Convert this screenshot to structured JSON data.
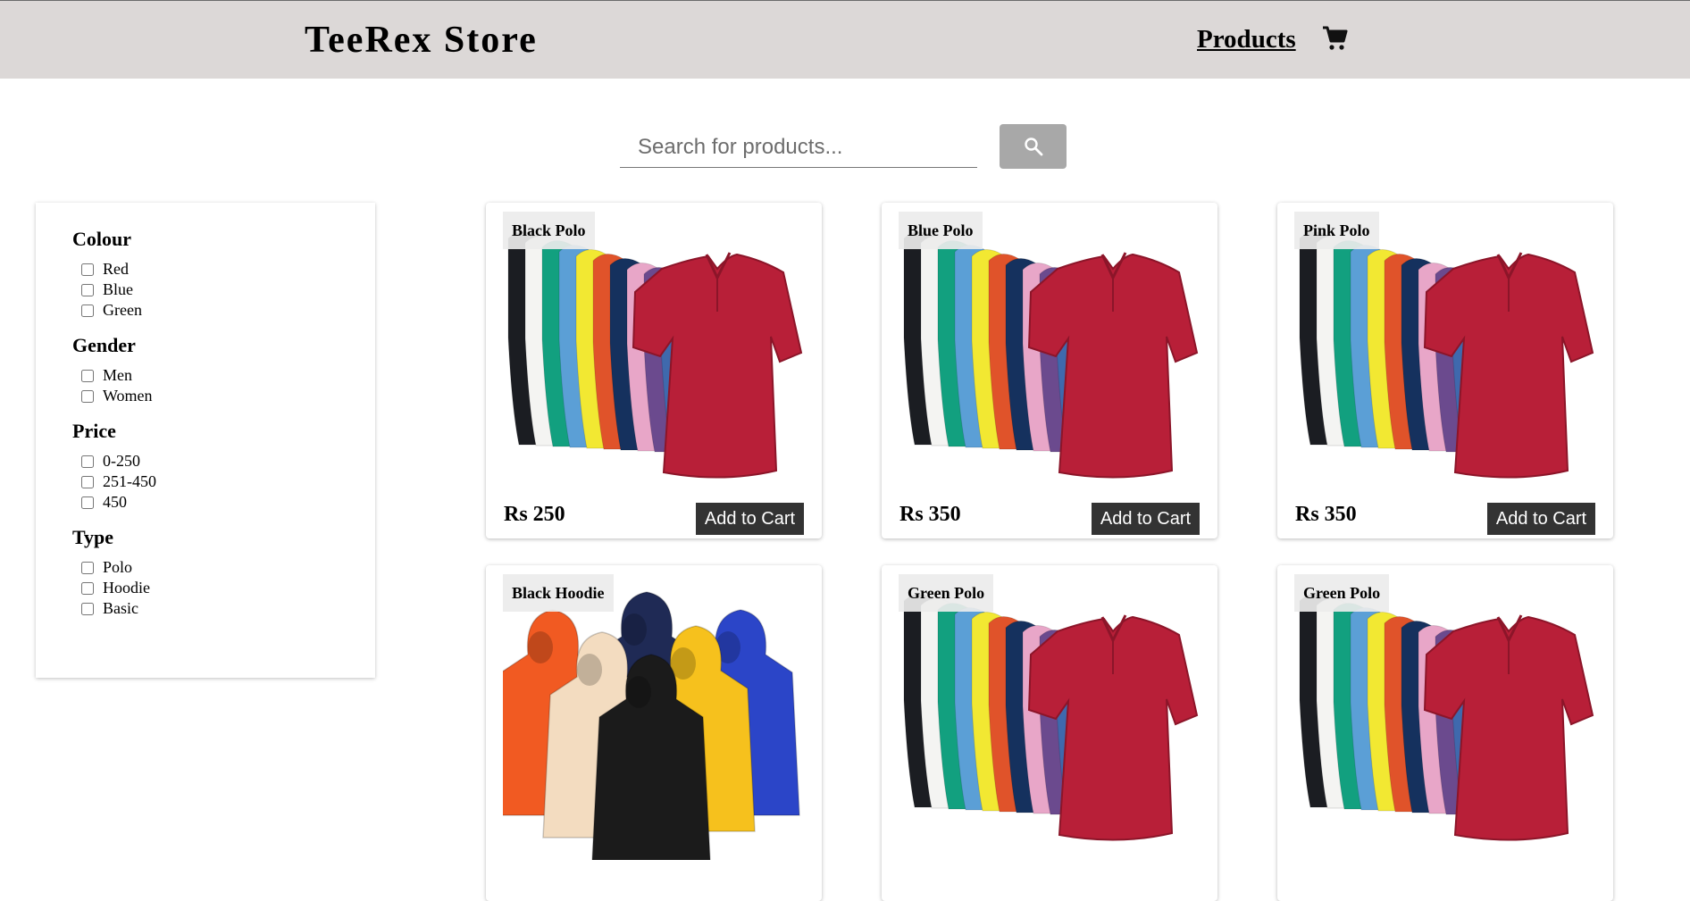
{
  "header": {
    "brand": "TeeRex Store",
    "nav_products": "Products",
    "cart_icon": "shopping-cart-icon"
  },
  "search": {
    "placeholder": "Search for products...",
    "value": "",
    "button_icon": "search-icon"
  },
  "filters": [
    {
      "title": "Colour",
      "options": [
        "Red",
        "Blue",
        "Green"
      ]
    },
    {
      "title": "Gender",
      "options": [
        "Men",
        "Women"
      ]
    },
    {
      "title": "Price",
      "options": [
        "0-250",
        "251-450",
        "450"
      ]
    },
    {
      "title": "Type",
      "options": [
        "Polo",
        "Hoodie",
        "Basic"
      ]
    }
  ],
  "products": [
    {
      "name": "Black Polo",
      "price": "Rs 250",
      "button": "Add to Cart",
      "image": "polo"
    },
    {
      "name": "Blue Polo",
      "price": "Rs 350",
      "button": "Add to Cart",
      "image": "polo"
    },
    {
      "name": "Pink Polo",
      "price": "Rs 350",
      "button": "Add to Cart",
      "image": "polo"
    },
    {
      "name": "Black Hoodie",
      "price": "",
      "button": "",
      "image": "hoodie"
    },
    {
      "name": "Green Polo",
      "price": "",
      "button": "",
      "image": "polo"
    },
    {
      "name": "Green Polo",
      "price": "",
      "button": "",
      "image": "polo"
    }
  ],
  "colors": {
    "header_bg": "#dcd8d7",
    "button_dark": "#333333",
    "search_button": "#a8a8a8"
  }
}
